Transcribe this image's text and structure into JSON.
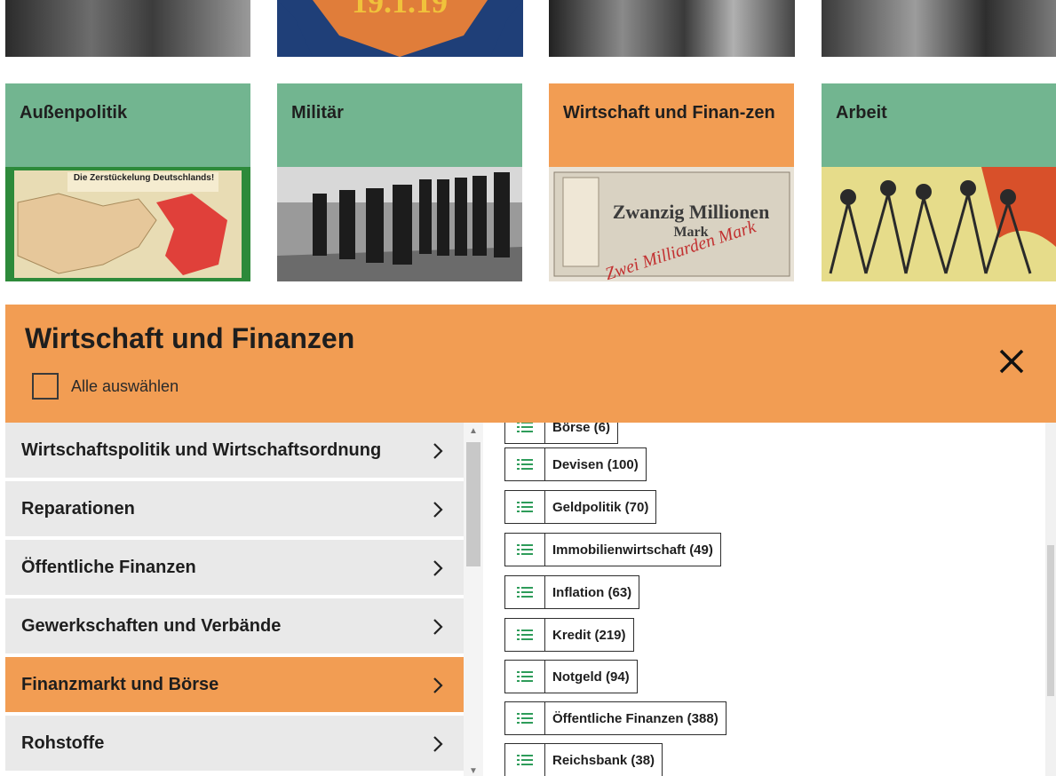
{
  "categories": [
    {
      "title": "Außenpolitik",
      "color": "#72b590"
    },
    {
      "title": "Militär",
      "color": "#72b590"
    },
    {
      "title": "Wirtschaft und Finan-zen",
      "color": "#f29d53"
    },
    {
      "title": "Arbeit",
      "color": "#72b590"
    }
  ],
  "banner_text": "19.1.19",
  "panel": {
    "title": "Wirtschaft und Finanzen",
    "select_all_label": "Alle auswählen",
    "close_icon": "close-icon"
  },
  "left_items": [
    {
      "label": "Wirtschaftspolitik und Wirtschaftsordnung",
      "active": false
    },
    {
      "label": "Reparationen",
      "active": false
    },
    {
      "label": "Öffentliche Finanzen",
      "active": false
    },
    {
      "label": "Gewerkschaften und Verbände",
      "active": false
    },
    {
      "label": "Finanzmarkt und Börse",
      "active": true
    },
    {
      "label": "Rohstoffe",
      "active": false
    }
  ],
  "right_items": [
    {
      "label": "Börse (6)"
    },
    {
      "label": "Devisen (100)"
    },
    {
      "label": "Geldpolitik (70)"
    },
    {
      "label": "Immobilienwirtschaft (49)"
    },
    {
      "label": "Inflation (63)"
    },
    {
      "label": "Kredit (219)"
    },
    {
      "label": "Notgeld (94)"
    },
    {
      "label": "Öffentliche Finanzen (388)"
    },
    {
      "label": "Reichsbank (38)"
    }
  ],
  "colors": {
    "accent": "#f29d53",
    "green": "#72b590",
    "list_icon": "#2e9c5a"
  }
}
